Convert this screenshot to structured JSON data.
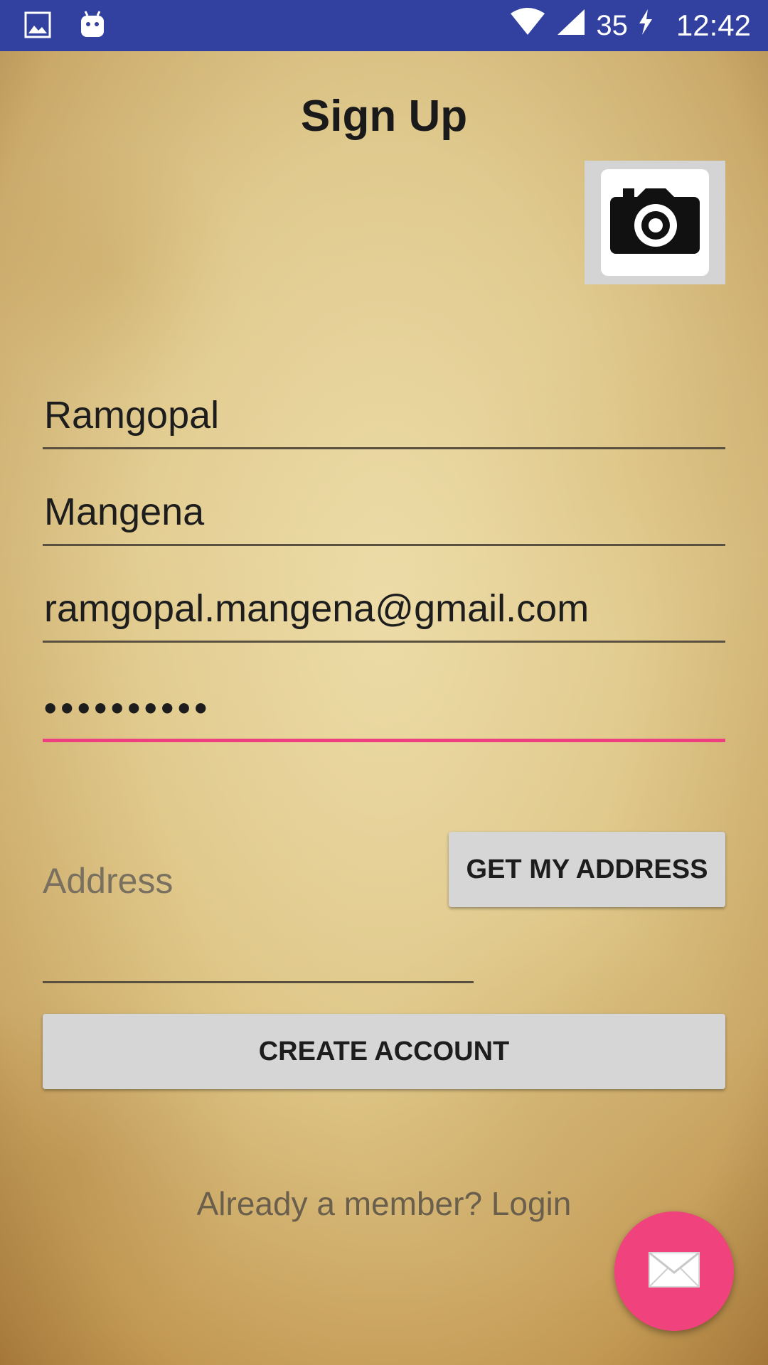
{
  "status_bar": {
    "battery": "35",
    "time": "12:42",
    "icons": [
      "image-icon",
      "android-icon",
      "wifi-icon",
      "signal-icon",
      "charging-icon"
    ]
  },
  "header": {
    "title": "Sign Up"
  },
  "form": {
    "first_name": "Ramgopal",
    "last_name": "Mangena",
    "email": "ramgopal.mangena@gmail.com",
    "password_masked": "••••••••••",
    "address_placeholder": "Address",
    "address_value": ""
  },
  "buttons": {
    "camera_icon": "camera-icon",
    "get_address_label": "GET MY ADDRESS",
    "create_account_label": "CREATE ACCOUNT",
    "fab_icon": "mail-icon"
  },
  "footer": {
    "login_prompt": "Already a member? Login"
  },
  "colors": {
    "status_bar": "#3240a0",
    "accent": "#f0437e",
    "button": "#d6d6d6"
  }
}
